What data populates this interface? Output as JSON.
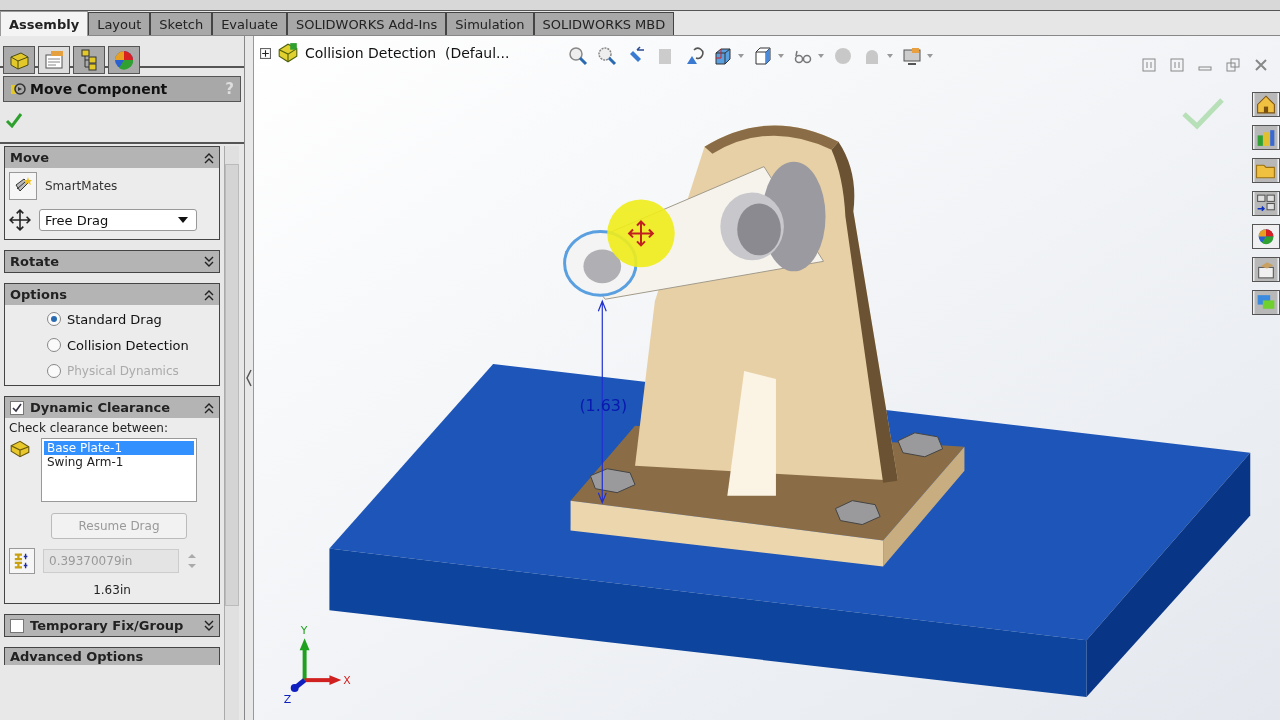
{
  "command_tabs": [
    {
      "label": "Assembly",
      "selected": true
    },
    {
      "label": "Layout",
      "selected": false
    },
    {
      "label": "Sketch",
      "selected": false
    },
    {
      "label": "Evaluate",
      "selected": false
    },
    {
      "label": "SOLIDWORKS Add-Ins",
      "selected": false
    },
    {
      "label": "Simulation",
      "selected": false
    },
    {
      "label": "SOLIDWORKS MBD",
      "selected": false
    }
  ],
  "tree_title": "Collision Detection  (Defaul...",
  "property_manager": {
    "title": "Move Component",
    "help": "?"
  },
  "move": {
    "title": "Move",
    "expanded": true,
    "smartmates": "SmartMates",
    "mode": "Free Drag"
  },
  "rotate": {
    "title": "Rotate",
    "expanded": false
  },
  "options": {
    "title": "Options",
    "expanded": true,
    "choices": [
      {
        "label": "Standard Drag",
        "selected": true,
        "disabled": false
      },
      {
        "label": "Collision Detection",
        "selected": false,
        "disabled": false
      },
      {
        "label": "Physical Dynamics",
        "selected": false,
        "disabled": true
      }
    ]
  },
  "dynamic_clearance": {
    "title": "Dynamic Clearance",
    "checked": true,
    "expanded": true,
    "prompt": "Check clearance between:",
    "components": [
      {
        "label": "Base Plate-1",
        "selected": true
      },
      {
        "label": "Swing Arm-1",
        "selected": false
      }
    ],
    "button": "Resume Drag",
    "button_disabled": true,
    "clearance": "0.39370079in",
    "distance": "1.63in"
  },
  "temporary_fix": {
    "title": "Temporary Fix/Group",
    "checked": false,
    "expanded": false
  },
  "advanced": {
    "title": "Advanced Options"
  },
  "viewport": {
    "dimension": "(1.63)",
    "axes": [
      "X",
      "Y",
      "Z"
    ]
  }
}
